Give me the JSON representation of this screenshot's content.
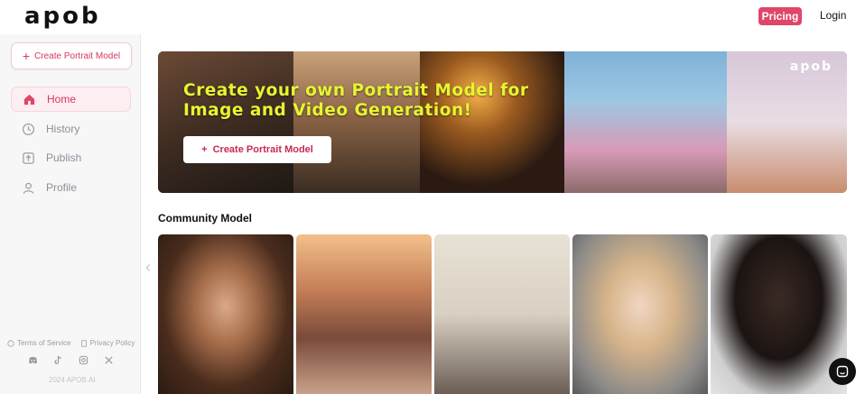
{
  "header": {
    "logo": "apob",
    "pricing_label": "Pricing",
    "login_label": "Login"
  },
  "sidebar": {
    "create_label": "Create Portrait Model",
    "items": [
      {
        "label": "Home",
        "icon": "home-icon",
        "active": true
      },
      {
        "label": "History",
        "icon": "clock-icon",
        "active": false
      },
      {
        "label": "Publish",
        "icon": "upload-icon",
        "active": false
      },
      {
        "label": "Profile",
        "icon": "user-icon",
        "active": false
      }
    ],
    "terms_label": "Terms of Service",
    "privacy_label": "Privacy Policy",
    "social_icons": [
      "discord-icon",
      "tiktok-icon",
      "instagram-icon",
      "x-icon"
    ],
    "copyright": "2024 APOB.AI"
  },
  "banner": {
    "logo": "apob",
    "title": "Create your own Portrait Model for Image and Video Generation!",
    "button_label": "Create Portrait Model"
  },
  "community": {
    "title": "Community Model",
    "cards": [
      {
        "name": "portrait-card-1"
      },
      {
        "name": "portrait-card-2"
      },
      {
        "name": "portrait-card-3"
      },
      {
        "name": "portrait-card-4"
      },
      {
        "name": "portrait-card-5"
      }
    ]
  },
  "colors": {
    "accent": "#e0456a",
    "accent_text": "#d6375e",
    "banner_title": "#e6f530"
  }
}
